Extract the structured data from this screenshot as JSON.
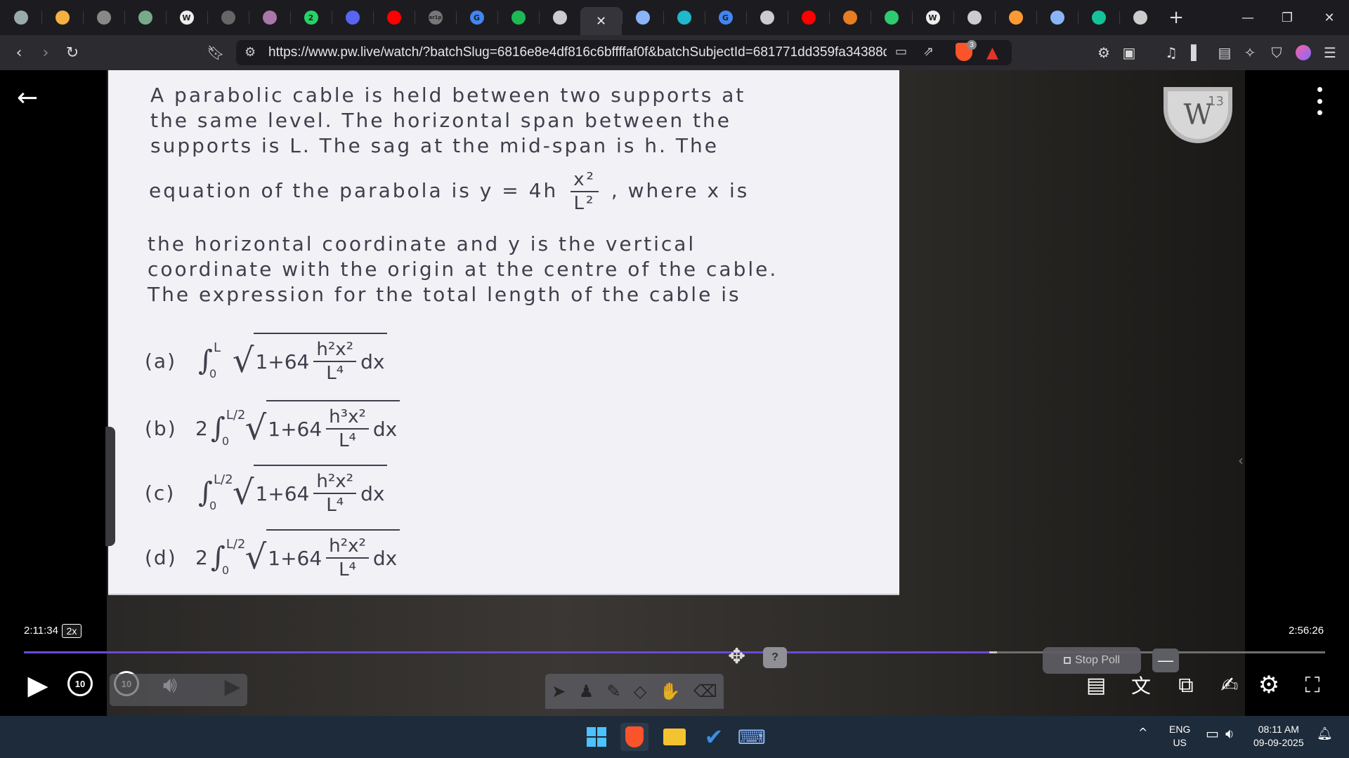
{
  "browser": {
    "tabs": [
      {
        "icon": "app-icon",
        "color": "#9aa"
      },
      {
        "icon": "gauge-icon",
        "color": "#f5b041"
      },
      {
        "icon": "circle-icon",
        "color": "#888"
      },
      {
        "icon": "book-icon",
        "color": "#7a8"
      },
      {
        "icon": "wix-icon",
        "color": "#eee",
        "text": "W"
      },
      {
        "icon": "circle-icon",
        "color": "#666"
      },
      {
        "icon": "brain-icon",
        "color": "#a7a"
      },
      {
        "icon": "whatsapp-icon",
        "color": "#25d366",
        "text": "2"
      },
      {
        "icon": "bookmark-icon",
        "color": "#5865f2"
      },
      {
        "icon": "youtube-icon",
        "color": "#ff0000"
      },
      {
        "icon": "scrip-icon",
        "color": "#777",
        "text": "ar1p"
      },
      {
        "icon": "google-icon",
        "color": "#4285f4",
        "text": "G"
      },
      {
        "icon": "spotify-icon",
        "color": "#1db954"
      },
      {
        "icon": "globe-icon",
        "color": "#ccc"
      },
      {
        "icon": "close-icon",
        "active": true
      },
      {
        "icon": "gemini-icon",
        "color": "#8ab4f8"
      },
      {
        "icon": "perplexity-icon",
        "color": "#20b8cd"
      },
      {
        "icon": "google-icon",
        "color": "#4285f4",
        "text": "G"
      },
      {
        "icon": "monitor-icon",
        "color": "#ccc"
      },
      {
        "icon": "youtube-icon",
        "color": "#ff0000"
      },
      {
        "icon": "globe-icon",
        "color": "#e67e22"
      },
      {
        "icon": "chart-icon",
        "color": "#2ecc71"
      },
      {
        "icon": "wikipedia-icon",
        "color": "#eee",
        "text": "W"
      },
      {
        "icon": "globe-icon",
        "color": "#ccc"
      },
      {
        "icon": "flag-icon",
        "color": "#ff9933"
      },
      {
        "icon": "gemini-icon",
        "color": "#8ab4f8"
      },
      {
        "icon": "grammarly-icon",
        "color": "#15c39a"
      },
      {
        "icon": "globe-icon",
        "color": "#ccc"
      }
    ],
    "new_tab_label": "+",
    "url": "https://www.pw.live/watch/?batchSlug=6816e8e4df816c6bffffaf0f&batchSubjectId=681771dd359fa34388d823e...",
    "brave_badge": "3"
  },
  "slide": {
    "q_line1": "A parabolic cable is held between two supports at",
    "q_line2": "the same level. The horizontal span between the",
    "q_line3": "supports is L. The sag at the mid-span is h. The",
    "q_eq_prefix": "equation of the parabola is  y = 4h",
    "q_eq_num": "x²",
    "q_eq_den": "L²",
    "q_eq_suffix": ", where x is",
    "q_line5": "the horizontal coordinate and y is the vertical",
    "q_line6": "coordinate with the origin at the centre of the cable.",
    "q_line7": "The expression for the total length of the cable is",
    "options": [
      {
        "label": "(a)",
        "coef": "",
        "upper": "L",
        "lower": "0",
        "num": "h²x²",
        "den": "L⁴"
      },
      {
        "label": "(b)",
        "coef": "2",
        "upper": "L/2",
        "lower": "0",
        "num": "h³x²",
        "den": "L⁴"
      },
      {
        "label": "(c)",
        "coef": "",
        "upper": "L/2",
        "lower": "0",
        "num": "h²x²",
        "den": "L⁴"
      },
      {
        "label": "(d)",
        "coef": "2",
        "upper": "L/2",
        "lower": "0",
        "num": "h²x²",
        "den": "L⁴"
      }
    ],
    "sqrt_prefix": "1+64",
    "dx": "dx"
  },
  "logo": {
    "letters": "W",
    "number": "13"
  },
  "player": {
    "current_time": "2:11:34",
    "speed": "2x",
    "duration": "2:56:26",
    "progress_fraction": 0.742,
    "buffer_fraction": 0.748,
    "skip_back_label": "10",
    "skip_forward_label": "10",
    "stop_poll_label": "Stop Poll",
    "help_label": "?"
  },
  "taskbar": {
    "lang_line1": "ENG",
    "lang_line2": "US",
    "time": "08:11 AM",
    "date": "09-09-2025"
  }
}
